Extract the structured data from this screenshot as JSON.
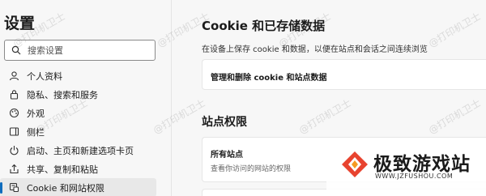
{
  "sidebar": {
    "title": "设置",
    "search_placeholder": "搜索设置",
    "items": [
      {
        "label": "个人资料",
        "icon": "profile-icon"
      },
      {
        "label": "隐私、搜索和服务",
        "icon": "lock-icon"
      },
      {
        "label": "外观",
        "icon": "appearance-icon"
      },
      {
        "label": "侧栏",
        "icon": "sidebar-icon"
      },
      {
        "label": "启动、主页和新建选项卡页",
        "icon": "power-icon"
      },
      {
        "label": "共享、复制和粘贴",
        "icon": "share-icon"
      },
      {
        "label": "Cookie 和网站权限",
        "icon": "cookie-icon",
        "active": true
      }
    ]
  },
  "main": {
    "title": "Cookie 和已存储数据",
    "description": "在设备上保存 cookie 和数据，以便在站点和会话之间连续浏览",
    "manage_label": "管理和删除 cookie 和站点数据",
    "site_permissions_title": "站点权限",
    "all_sites_label": "所有站点",
    "all_sites_desc": "查看你访问的网站的权限"
  },
  "watermark": "@打印机卫士",
  "logo": {
    "name": "极致游戏站",
    "url": "WWW.JZFUSHOU.COM"
  },
  "colors": {
    "accent": "#0f6cbd",
    "logo": "#e8432f"
  }
}
